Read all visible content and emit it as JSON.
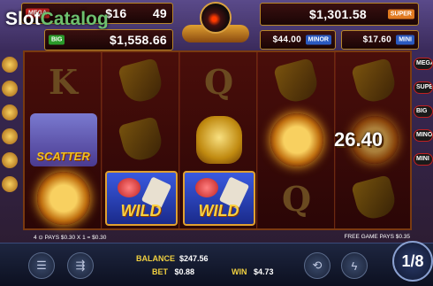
{
  "logo": {
    "text_main": "Slot",
    "text_accent": "Catalog"
  },
  "jackpots": {
    "mega": {
      "tag": "MEGA",
      "amount_partial": "$16",
      "amount_tail": "49"
    },
    "big": {
      "tag": "BIG",
      "amount": "$1,558.66"
    },
    "super": {
      "tag": "SUPER",
      "amount": "$1,301.58"
    },
    "minor": {
      "tag": "MINOR",
      "amount": "$44.00"
    },
    "mini": {
      "tag": "MINI",
      "amount": "$17.60"
    }
  },
  "reels": {
    "r1": [
      "K",
      "scatter",
      "mask"
    ],
    "r2": [
      "bag",
      "bag",
      "wild"
    ],
    "r3": [
      "Q",
      "cat",
      "wild"
    ],
    "r4": [
      "bag",
      "mask",
      "Q"
    ],
    "r5": [
      "bag",
      "win",
      "bag"
    ]
  },
  "symbols": {
    "scatter_label": "SCATTER",
    "wild_label": "WILD",
    "win_value": "26.40"
  },
  "side_right": [
    "MEGA",
    "SUPER",
    "BIG",
    "MINOR",
    "MINI"
  ],
  "info": {
    "left": "4 ⊙ PAYS $0.30 X 1 = $0.30",
    "right": "FREE GAME PAYS $0.35"
  },
  "stats": {
    "balance_label": "BALANCE",
    "balance": "$247.56",
    "bet_label": "BET",
    "bet": "$0.88",
    "win_label": "WIN",
    "win": "$4.73"
  },
  "spin": {
    "label": "1/8"
  },
  "icons": [
    "settings-icon",
    "auto-icon",
    "replay-icon",
    "turbo-icon"
  ]
}
